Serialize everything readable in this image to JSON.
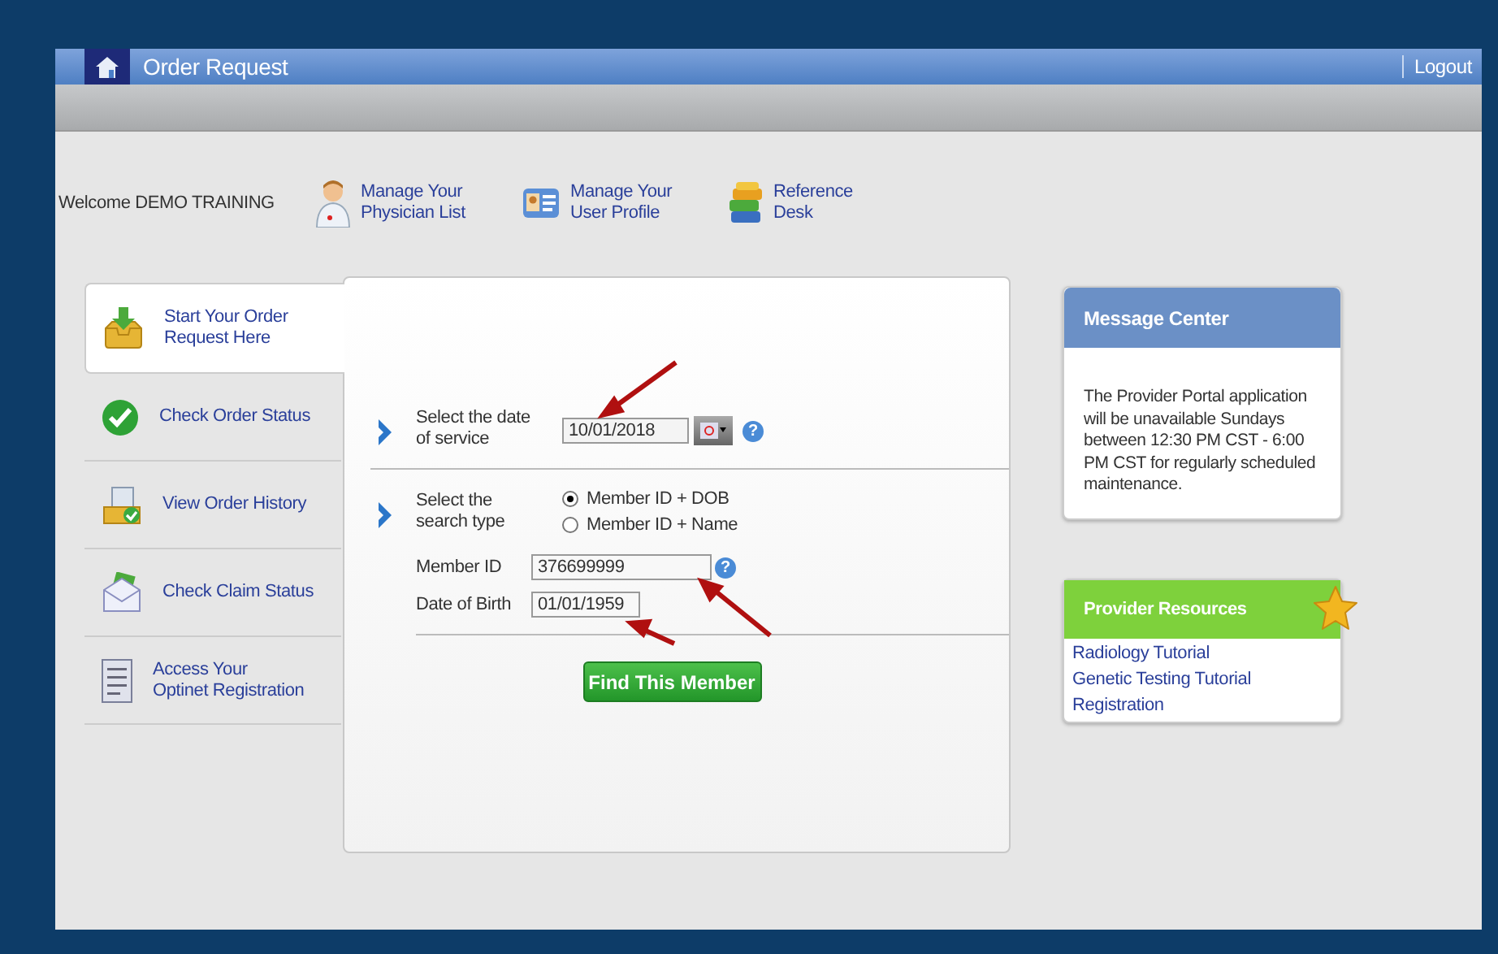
{
  "window": {
    "title": "Order Request",
    "logout": "Logout"
  },
  "header": {
    "welcome": "Welcome DEMO TRAINING",
    "links": [
      {
        "kind": "physician",
        "lines": [
          "Manage Your",
          "Physician List"
        ]
      },
      {
        "kind": "profile",
        "lines": [
          "Manage Your",
          "User Profile"
        ]
      },
      {
        "kind": "books",
        "lines": [
          "Reference",
          "Desk"
        ]
      }
    ]
  },
  "nav": [
    {
      "kind": "inbox",
      "lines": [
        "Start Your Order",
        "Request Here"
      ],
      "selected": true
    },
    {
      "kind": "check",
      "lines": [
        "Check Order Status"
      ],
      "selected": false
    },
    {
      "kind": "history",
      "lines": [
        "View Order History"
      ],
      "selected": false
    },
    {
      "kind": "envelope",
      "lines": [
        "Check Claim Status"
      ],
      "selected": false
    },
    {
      "kind": "document",
      "lines": [
        "Access Your",
        "Optinet Registration"
      ],
      "selected": false
    }
  ],
  "form": {
    "date_of_service": {
      "lines": [
        "Select the date",
        "of service"
      ],
      "value": "10/01/2018",
      "help": "?"
    },
    "search_type": {
      "lines": [
        "Select the",
        "search type"
      ],
      "options": [
        {
          "label": "Member ID + DOB",
          "selected": true
        },
        {
          "label": "Member ID + Name",
          "selected": false
        }
      ]
    },
    "fields": [
      {
        "label": "Member ID",
        "value": "376699999",
        "help": "?"
      },
      {
        "label": "Date of Birth",
        "value": "01/01/1959"
      }
    ],
    "button": "Find This Member"
  },
  "message_center": {
    "title": "Message Center",
    "text": "The Provider Portal application will be unavailable Sundays between 12:30 PM CST - 6:00 PM CST for regularly scheduled maintenance."
  },
  "provider_resources": {
    "title": "Provider Resources",
    "links": [
      "Radiology Tutorial",
      "Genetic Testing Tutorial",
      "Registration"
    ]
  }
}
